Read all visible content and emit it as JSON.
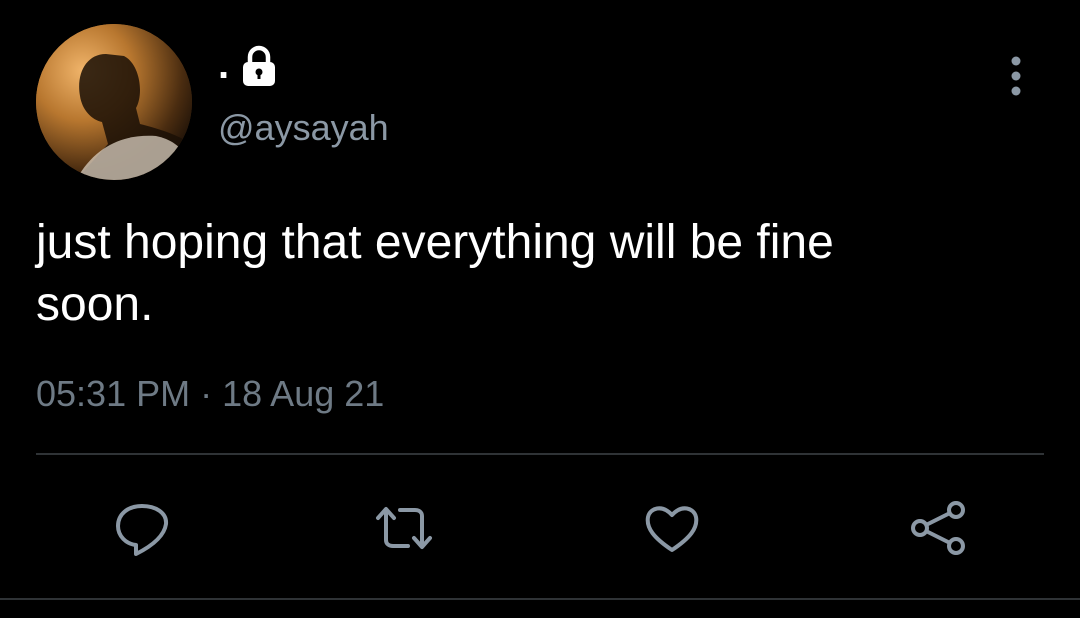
{
  "tweet": {
    "display_name": ".",
    "handle": "@aysayah",
    "text": "just hoping that everything will be fine\nsoon.",
    "time": "05:31 PM",
    "separator": "·",
    "date": "18 Aug 21"
  },
  "icons": {
    "lock": "lock-icon",
    "more": "more-vertical-icon",
    "reply": "reply-icon",
    "retweet": "retweet-icon",
    "like": "heart-icon",
    "share": "share-icon"
  },
  "colors": {
    "background": "#000000",
    "text": "#ffffff",
    "secondary_text": "#8b98a5",
    "icon": "#8b98a5",
    "divider": "#2f3336"
  }
}
